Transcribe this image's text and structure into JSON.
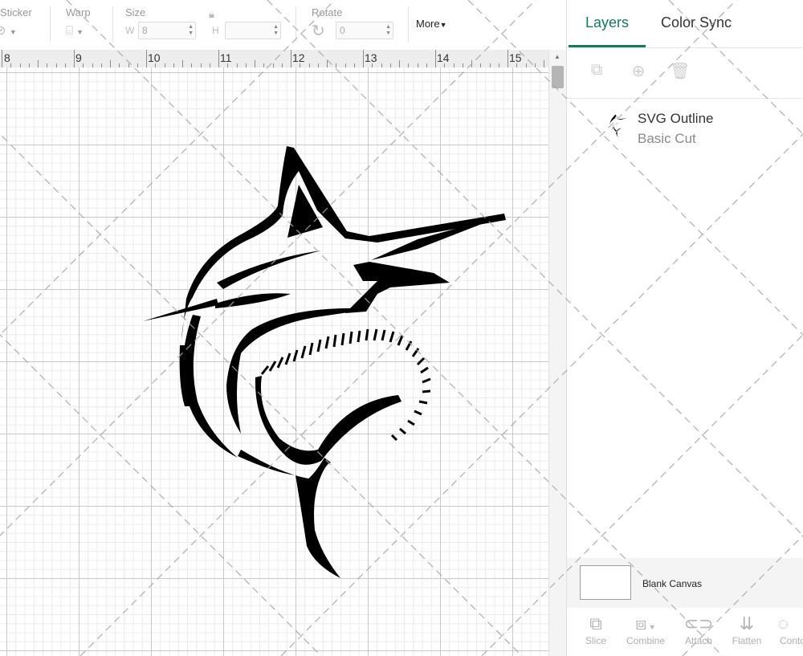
{
  "toolbar": {
    "sticker_label": "Sticker",
    "warp_label": "Warp",
    "size_label": "Size",
    "size_w_prefix": "W",
    "size_w_value": "8",
    "size_h_prefix": "H",
    "size_h_value": "",
    "rotate_label": "Rotate",
    "rotate_value": "0",
    "more_label": "More"
  },
  "ruler": {
    "ticks": [
      "8",
      "9",
      "10",
      "11",
      "12",
      "13",
      "14",
      "15"
    ]
  },
  "panel": {
    "tabs": [
      {
        "label": "Layers",
        "active": true
      },
      {
        "label": "Color Sync",
        "active": false
      }
    ],
    "layer_tools": [
      "group-icon",
      "duplicate-icon",
      "delete-icon"
    ],
    "layers": [
      {
        "name": "SVG Outline",
        "operation": "Basic Cut",
        "icon": "marlin-thumbnail-icon"
      }
    ],
    "blank_canvas_label": "Blank Canvas",
    "bottom_tools": [
      {
        "label": "Slice",
        "icon": "slice-icon"
      },
      {
        "label": "Combine",
        "icon": "combine-icon"
      },
      {
        "label": "Attach",
        "icon": "attach-icon"
      },
      {
        "label": "Flatten",
        "icon": "flatten-icon"
      },
      {
        "label": "Conto",
        "icon": "contour-icon"
      }
    ]
  },
  "colors": {
    "accent": "#157a5c",
    "grid_major": "#c9c9c9",
    "grid_minor": "#ececec",
    "artwork": "#000000"
  }
}
